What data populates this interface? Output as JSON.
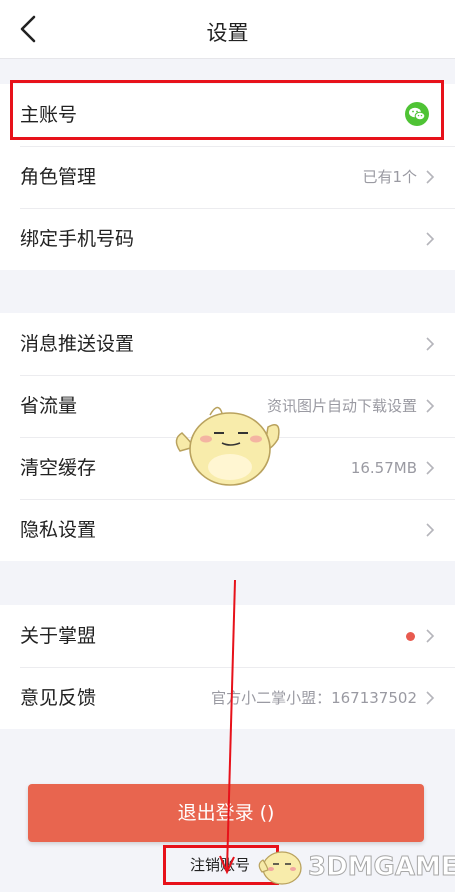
{
  "header": {
    "title": "设置"
  },
  "account_group": [
    {
      "label": "主账号",
      "value": "",
      "icon": "wechat-icon"
    },
    {
      "label": "角色管理",
      "value": "已有1个"
    },
    {
      "label": "绑定手机号码",
      "value": ""
    }
  ],
  "settings_group": [
    {
      "label": "消息推送设置",
      "value": ""
    },
    {
      "label": "省流量",
      "value": "资讯图片自动下载设置"
    },
    {
      "label": "清空缓存",
      "value": "16.57MB"
    },
    {
      "label": "隐私设置",
      "value": ""
    }
  ],
  "about_group": [
    {
      "label": "关于掌盟",
      "value": "",
      "badge": "red-dot"
    },
    {
      "label": "意见反馈",
      "value": "官方小二掌小盟：167137502"
    }
  ],
  "logout_label": "退出登录 ()",
  "cancel_account_label": "注销账号",
  "watermark": "3DMGAME",
  "colors": {
    "accent": "#e8654f",
    "wechat": "#4fc335",
    "highlight": "#e7111a"
  }
}
